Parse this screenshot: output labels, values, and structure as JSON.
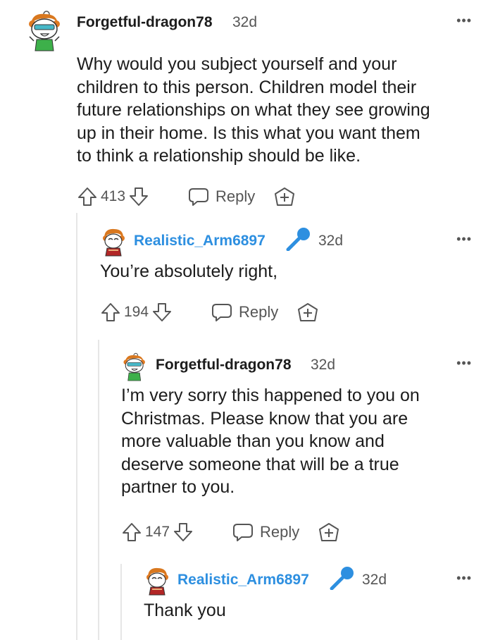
{
  "comments": [
    {
      "username": "Forgetful-dragon78",
      "time": "32d",
      "more": "•••",
      "lines": [
        "Why would you subject yourself and your",
        "children to this person. Children model their",
        "future relationships on what they see growing",
        "up in their home. Is this what you want them",
        "to think a relationship should be like."
      ],
      "votes": "413",
      "reply_label": "Reply"
    },
    {
      "username": "Realistic_Arm6897",
      "time": "32d",
      "more": "•••",
      "lines": [
        "You’re absolutely right,"
      ],
      "votes": "194",
      "reply_label": "Reply"
    },
    {
      "username": "Forgetful-dragon78",
      "time": "32d",
      "more": "•••",
      "lines": [
        "I’m very sorry this happened to you on",
        "Christmas. Please know that you are",
        "more valuable than you know and",
        "deserve someone that will be a true",
        "partner to you."
      ],
      "votes": "147",
      "reply_label": "Reply"
    },
    {
      "username": "Realistic_Arm6897",
      "time": "32d",
      "more": "•••",
      "lines": [
        "Thank you"
      ]
    }
  ],
  "colors": {
    "op_name": "#1c1c1c",
    "flair_name": "#2d8fe0",
    "meta": "#555555",
    "thread_line": "#e6e6e6"
  },
  "icons": [
    "avatar-dragon",
    "avatar-realistic",
    "microphone-icon",
    "upvote-icon",
    "downvote-icon",
    "chat-bubble-icon",
    "award-plus-icon",
    "more-dots-icon"
  ]
}
